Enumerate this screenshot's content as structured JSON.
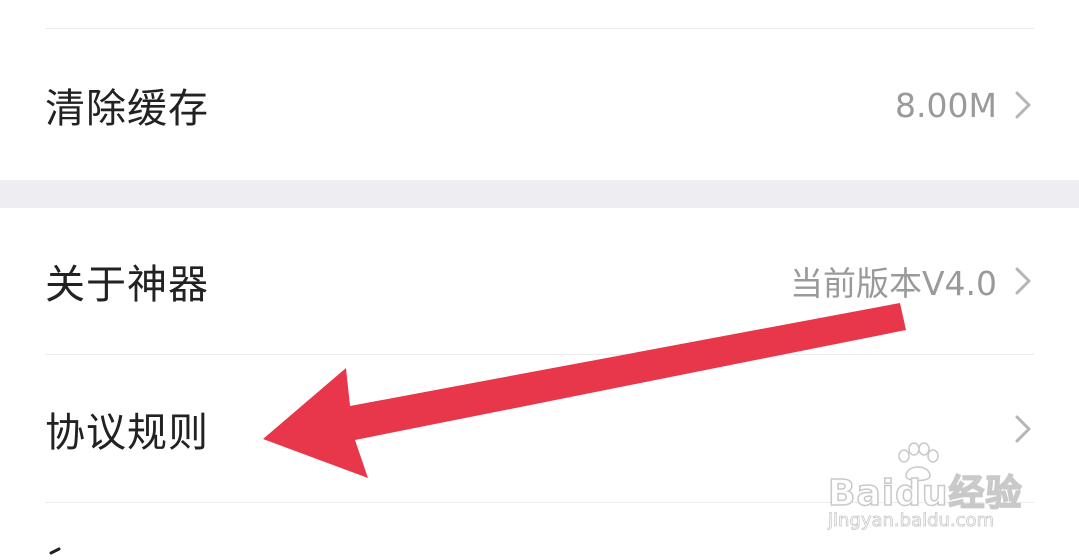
{
  "settings": {
    "rows": [
      {
        "label": "清除缓存",
        "value": "8.00M"
      },
      {
        "label": "关于神器",
        "value": "当前版本V4.0"
      },
      {
        "label": "协议规则",
        "value": ""
      }
    ]
  },
  "annotation": {
    "arrow_color": "#e8364a",
    "arrow_target": "协议规则"
  },
  "watermark": {
    "logo_text": "Baidu经验",
    "url": "jingyan.baidu.com"
  },
  "colors": {
    "label": "#222222",
    "value": "#9a9a9a",
    "divider": "#ececec",
    "section_gap": "#eeeef2",
    "chevron": "#b5b5b5"
  },
  "icons": {
    "row_chevron": "chevron-right-icon"
  }
}
